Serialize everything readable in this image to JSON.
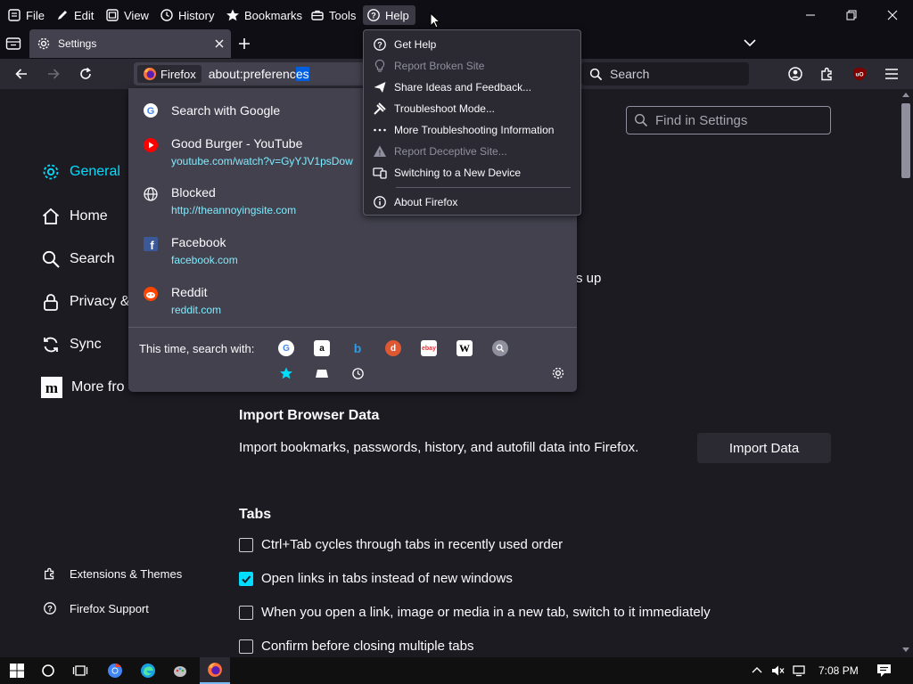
{
  "menubar": {
    "items": [
      {
        "label": "File",
        "icon": "file-menu-icon"
      },
      {
        "label": "Edit",
        "icon": "pencil-icon"
      },
      {
        "label": "View",
        "icon": "view-icon"
      },
      {
        "label": "History",
        "icon": "clock-icon"
      },
      {
        "label": "Bookmarks",
        "icon": "star-icon"
      },
      {
        "label": "Tools",
        "icon": "toolbox-icon"
      },
      {
        "label": "Help",
        "icon": "help-circle-icon",
        "active": true
      }
    ]
  },
  "tabbar": {
    "tab_title": "Settings"
  },
  "urlbar": {
    "identity_label": "Firefox",
    "value_plain": "about:preferenc",
    "value_selected": "es"
  },
  "searchbar": {
    "placeholder": "Search"
  },
  "url_dropdown": {
    "search_suggestion": "Search with Google",
    "results": [
      {
        "title": "Good Burger - YouTube",
        "url": "youtube.com/watch?v=GyYJV1psDow",
        "icon": "youtube-icon"
      },
      {
        "title": "Blocked",
        "url": "http://theannoyingsite.com",
        "icon": "globe-icon"
      },
      {
        "title": "Facebook",
        "url": "facebook.com",
        "icon": "facebook-icon"
      },
      {
        "title": "Reddit",
        "url": "reddit.com",
        "icon": "reddit-icon"
      }
    ],
    "one_off_label": "This time, search with:",
    "engines": [
      "google",
      "amazon",
      "bing",
      "duckduckgo",
      "ebay",
      "wikipedia",
      "other"
    ]
  },
  "help_menu": {
    "items": [
      {
        "label": "Get Help",
        "icon": "help-circle-icon",
        "enabled": true
      },
      {
        "label": "Report Broken Site",
        "icon": "lightbulb-icon",
        "enabled": false
      },
      {
        "label": "Share Ideas and Feedback...",
        "icon": "send-icon",
        "enabled": true
      },
      {
        "label": "Troubleshoot Mode...",
        "icon": "tools-icon",
        "enabled": true
      },
      {
        "label": "More Troubleshooting Information",
        "icon": "dots-icon",
        "enabled": true
      },
      {
        "label": "Report Deceptive Site...",
        "icon": "warning-icon",
        "enabled": false
      },
      {
        "label": "Switching to a New Device",
        "icon": "devices-icon",
        "enabled": true
      },
      {
        "label": "About Firefox",
        "icon": "info-icon",
        "enabled": true
      }
    ]
  },
  "settings": {
    "find_placeholder": "Find in Settings",
    "categories": [
      {
        "label": "General",
        "icon": "gear-icon",
        "selected": true
      },
      {
        "label": "Home",
        "icon": "home-icon"
      },
      {
        "label": "Search",
        "icon": "search-icon"
      },
      {
        "label": "Privacy &",
        "icon": "lock-icon"
      },
      {
        "label": "Sync",
        "icon": "sync-icon"
      },
      {
        "label": "More fro",
        "icon": "mozilla-icon"
      }
    ],
    "footer_links": [
      {
        "label": "Extensions & Themes",
        "icon": "puzzle-icon"
      },
      {
        "label": "Firefox Support",
        "icon": "help-circle-icon"
      }
    ],
    "partial_text": "s up",
    "import_heading": "Import Browser Data",
    "import_desc": "Import bookmarks, passwords, history, and autofill data into Firefox.",
    "import_button": "Import Data",
    "tabs_heading": "Tabs",
    "tabs_options": [
      {
        "label": "Ctrl+Tab cycles through tabs in recently used order",
        "checked": false
      },
      {
        "label": "Open links in tabs instead of new windows",
        "checked": true
      },
      {
        "label": "When you open a link, image or media in a new tab, switch to it immediately",
        "checked": false
      },
      {
        "label": "Confirm before closing multiple tabs",
        "checked": false
      }
    ]
  },
  "taskbar": {
    "time": "7:08 PM"
  },
  "colors": {
    "accent": "#00ddff",
    "link": "#80ebff",
    "page_bg": "#1c1b22",
    "popup_bg": "#42414d"
  }
}
